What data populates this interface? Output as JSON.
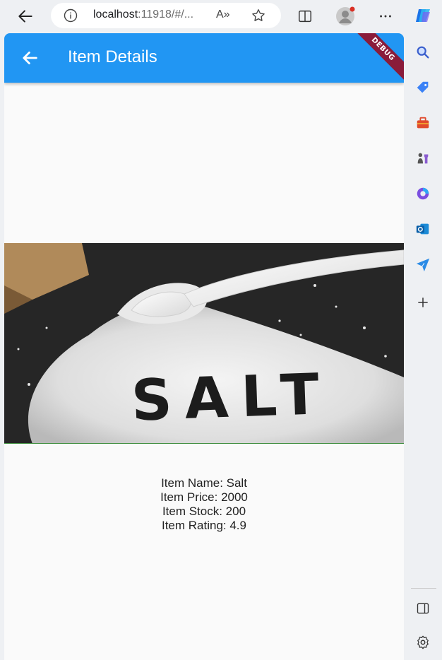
{
  "browser": {
    "url_host": "localhost",
    "url_rest": ":11918/#/...",
    "read_aloud_label": "A»"
  },
  "app": {
    "title": "Item Details",
    "debug_banner": "DEBUG"
  },
  "image": {
    "word": "SALT"
  },
  "item": {
    "name_line": "Item Name: Salt",
    "price_line": "Item Price: 2000",
    "stock_line": "Item Stock: 200",
    "rating_line": "Item Rating: 4.9"
  },
  "colors": {
    "app_bar": "#2196f3",
    "debug_ribbon": "#8a1c3a",
    "background": "#fafafa"
  }
}
